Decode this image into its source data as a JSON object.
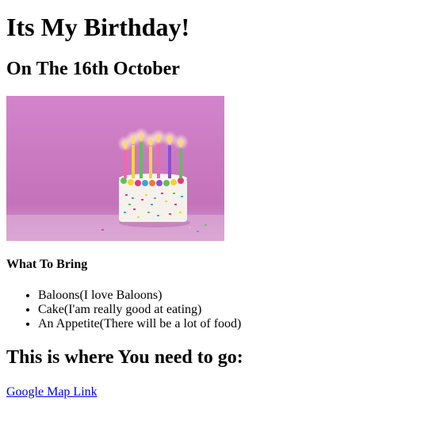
{
  "page": {
    "title": "Its My Birthday!",
    "date_heading": "On The 16th October"
  },
  "image": {
    "description_icon": "birthday-cake-icon",
    "colors": {
      "background_top": "#cf7ec6",
      "background_bottom": "#c06fb6",
      "table": "#e8c4e2",
      "cake_body": "#f7f1ec"
    }
  },
  "bring": {
    "heading": "What To Bring",
    "items": [
      {
        "label": "Baloons(I love Baloons)"
      },
      {
        "label": "Cake(I'am really good at eating)"
      },
      {
        "label": "An Appetite(There will be a lot of food)"
      }
    ]
  },
  "directions": {
    "heading": "This is where You need to go:",
    "link_label": "Google Map Link"
  }
}
